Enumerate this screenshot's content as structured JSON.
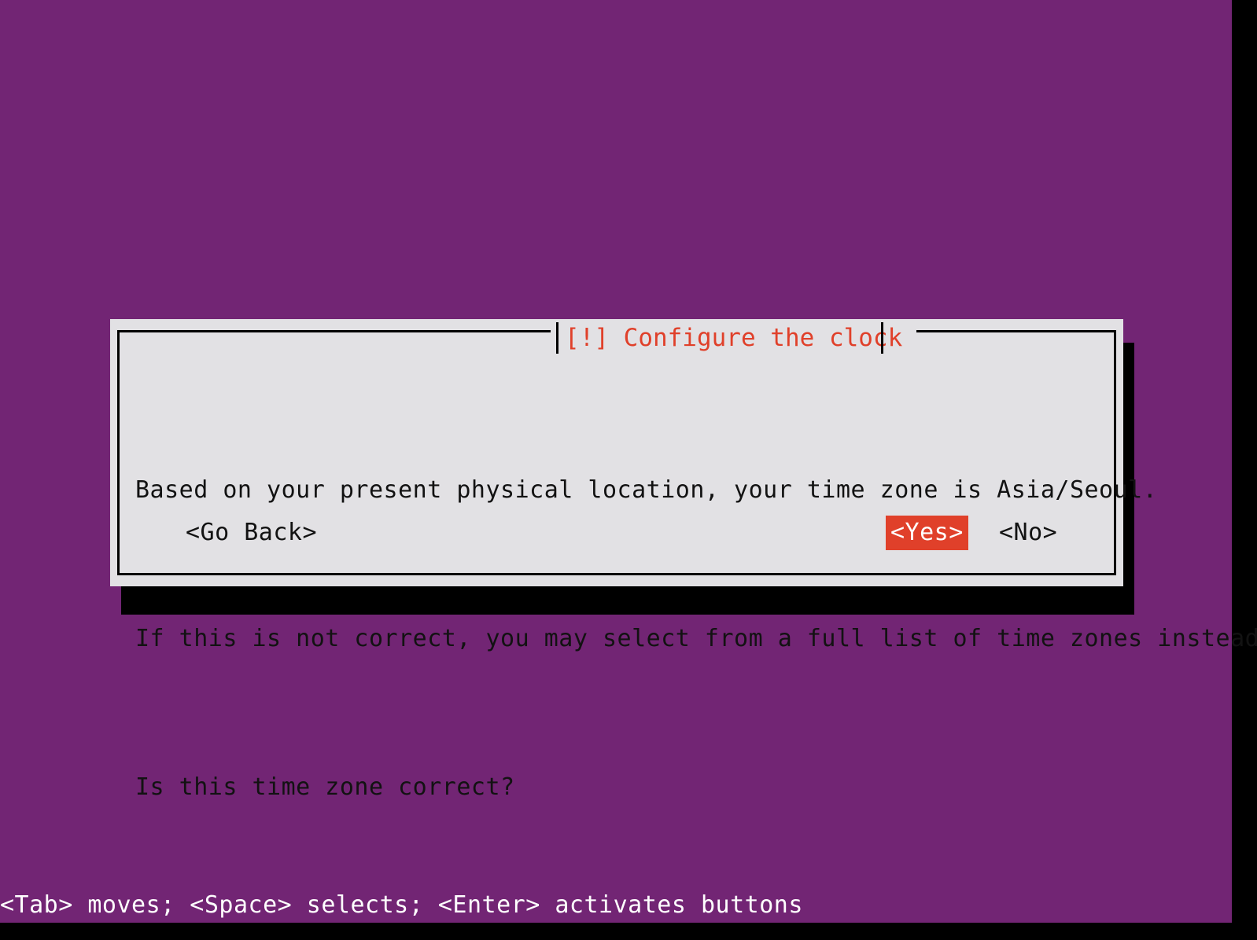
{
  "screen": {
    "background_color": "#722574",
    "gutter_color": "#000000"
  },
  "dialog": {
    "title": "[!] Configure the clock",
    "title_color": "#e0402a",
    "panel_color": "#e2e1e4",
    "border_color": "#000000",
    "body_lines": [
      "Based on your present physical location, your time zone is Asia/Seoul.",
      "If this is not correct, you may select from a full list of time zones instead.",
      "Is this time zone correct?"
    ],
    "buttons": {
      "go_back": "<Go Back>",
      "yes": "<Yes>",
      "no": "<No>",
      "selected": "<Yes>",
      "highlight_color": "#e0402a",
      "highlight_text_color": "#ffffff"
    }
  },
  "footer": {
    "help_text": "<Tab> moves; <Space> selects; <Enter> activates buttons",
    "text_color": "#ffffff"
  }
}
